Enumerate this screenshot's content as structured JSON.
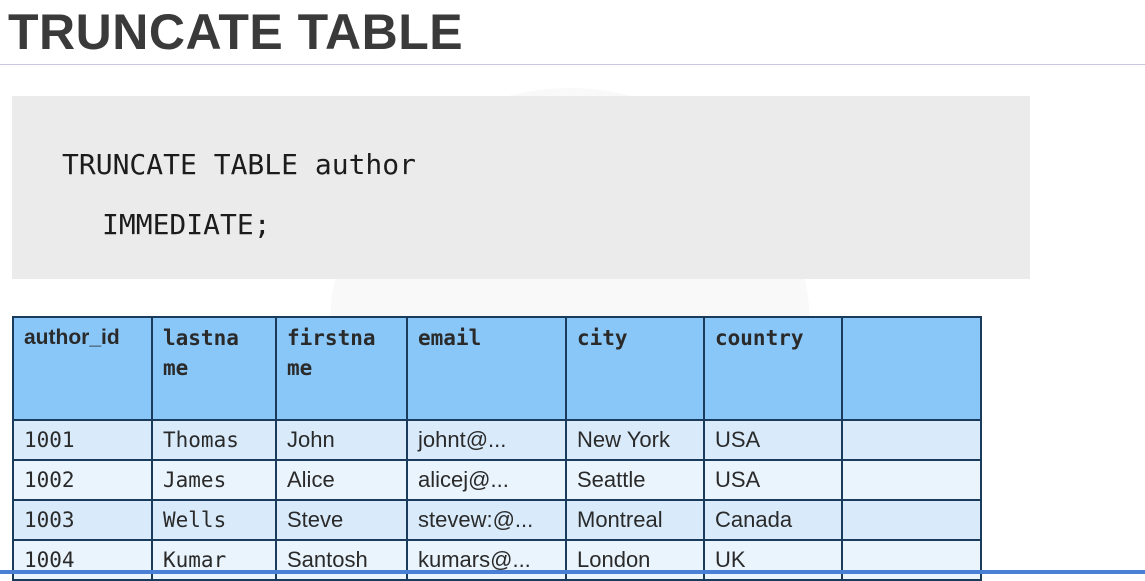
{
  "slide": {
    "title": "TRUNCATE TABLE"
  },
  "code": {
    "line1": "TRUNCATE TABLE author",
    "line2": "IMMEDIATE;"
  },
  "table": {
    "headers": [
      "author_id",
      "lastna\nme",
      "firstna\nme",
      "email",
      "city",
      "country",
      ""
    ],
    "rows": [
      [
        "1001",
        "Thomas",
        "John",
        "johnt@...",
        "New York",
        "USA",
        ""
      ],
      [
        "1002",
        "James",
        "Alice",
        "alicej@...",
        "Seattle",
        "USA",
        ""
      ],
      [
        "1003",
        "Wells",
        "Steve",
        "stevew:@...",
        "Montreal",
        "Canada",
        ""
      ],
      [
        "1004",
        "Kumar",
        "Santosh",
        "kumars@...",
        "London",
        "UK",
        ""
      ]
    ]
  }
}
